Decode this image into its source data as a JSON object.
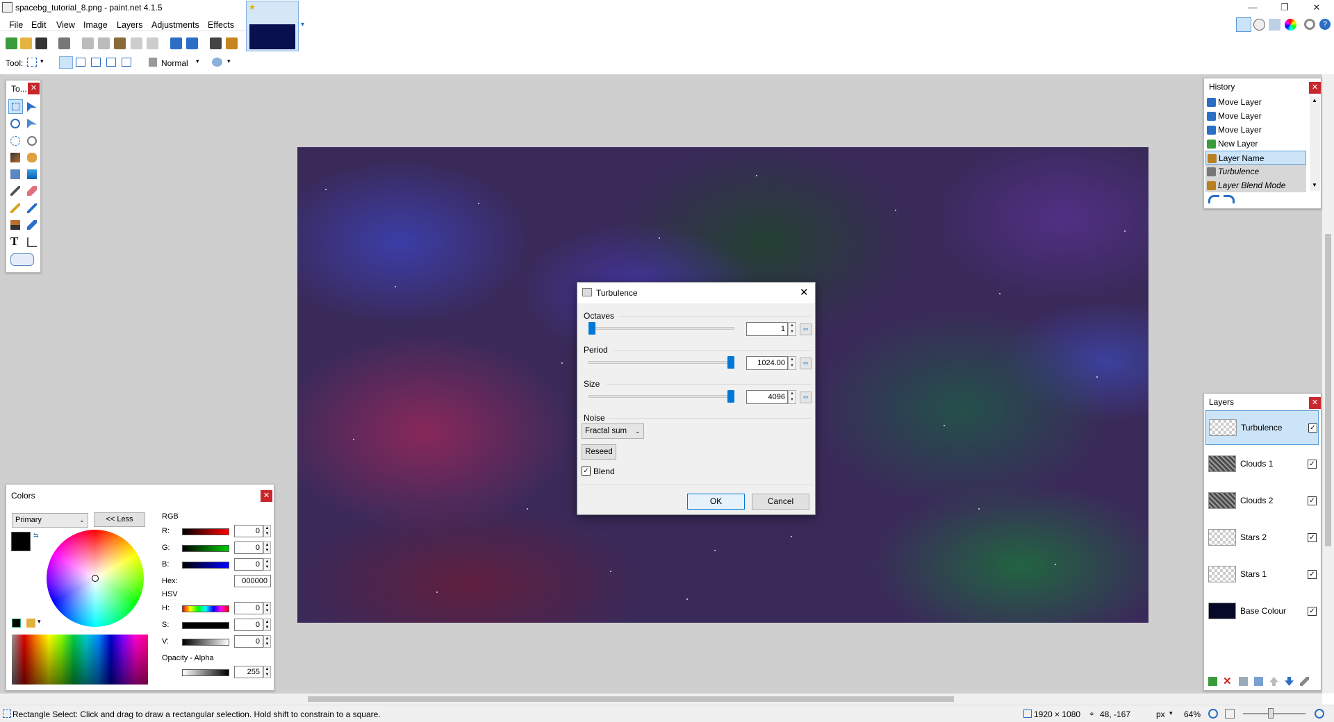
{
  "window": {
    "title": "spacebg_tutorial_8.png - paint.net 4.1.5",
    "minimize": "—",
    "restore": "❐",
    "close": "✕"
  },
  "menu": [
    "File",
    "Edit",
    "View",
    "Image",
    "Layers",
    "Adjustments",
    "Effects"
  ],
  "toolbar": {
    "tool_label": "Tool:",
    "blend_mode": "Normal"
  },
  "tools_panel": {
    "title": "To..."
  },
  "history": {
    "title": "History",
    "items": [
      {
        "label": "Move Layer",
        "state": "normal"
      },
      {
        "label": "Move Layer",
        "state": "normal"
      },
      {
        "label": "Move Layer",
        "state": "normal"
      },
      {
        "label": "New Layer",
        "state": "normal"
      },
      {
        "label": "Layer Name",
        "state": "selected"
      },
      {
        "label": "Turbulence",
        "state": "undone"
      },
      {
        "label": "Layer Blend Mode",
        "state": "undone"
      }
    ]
  },
  "layers": {
    "title": "Layers",
    "items": [
      {
        "name": "Turbulence",
        "visible": true,
        "selected": true
      },
      {
        "name": "Clouds 1",
        "visible": true
      },
      {
        "name": "Clouds 2",
        "visible": true
      },
      {
        "name": "Stars 2",
        "visible": true
      },
      {
        "name": "Stars 1",
        "visible": true
      },
      {
        "name": "Base Colour",
        "visible": true
      }
    ]
  },
  "dialog": {
    "title": "Turbulence",
    "octaves": {
      "label": "Octaves",
      "value": "1",
      "fraction": 0.0
    },
    "period": {
      "label": "Period",
      "value": "1024.00",
      "fraction": 1.0
    },
    "size": {
      "label": "Size",
      "value": "4096",
      "fraction": 1.0
    },
    "noise": {
      "label": "Noise",
      "value": "Fractal sum"
    },
    "reseed": "Reseed",
    "blend": {
      "label": "Blend",
      "checked": true
    },
    "ok": "OK",
    "cancel": "Cancel"
  },
  "colors": {
    "title": "Colors",
    "mode": "Primary",
    "less": "<< Less",
    "rgb_label": "RGB",
    "hsv_label": "HSV",
    "r": {
      "label": "R:",
      "value": "0"
    },
    "g": {
      "label": "G:",
      "value": "0"
    },
    "b": {
      "label": "B:",
      "value": "0"
    },
    "hex": {
      "label": "Hex:",
      "value": "000000"
    },
    "h": {
      "label": "H:",
      "value": "0"
    },
    "s": {
      "label": "S:",
      "value": "0"
    },
    "v": {
      "label": "V:",
      "value": "0"
    },
    "opacity": {
      "label": "Opacity - Alpha",
      "value": "255"
    }
  },
  "status": {
    "hint": "Rectangle Select: Click and drag to draw a rectangular selection. Hold shift to constrain to a square.",
    "image_size": "1920 × 1080",
    "cursor": "48, -167",
    "units": "px",
    "zoom": "64%"
  }
}
